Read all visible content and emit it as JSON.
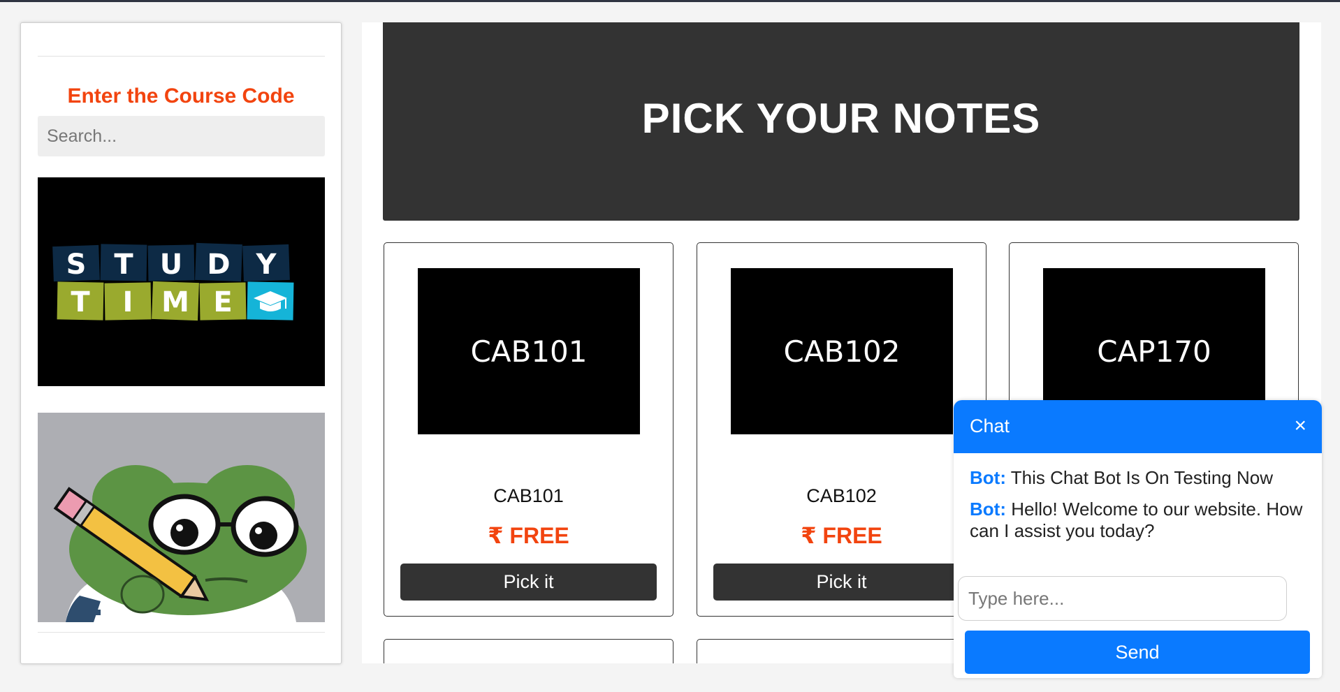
{
  "sidebar": {
    "heading": "Enter the Course Code",
    "search_placeholder": "Search...",
    "promo_logo_letters_top": [
      "S",
      "T",
      "U",
      "D",
      "Y"
    ],
    "promo_logo_letters_bottom": [
      "T",
      "I",
      "M",
      "E"
    ]
  },
  "banner": {
    "title": "PICK YOUR NOTES"
  },
  "courses": [
    {
      "thumb": "CAB101",
      "code": "CAB101",
      "price": "₹ FREE",
      "button": "Pick it"
    },
    {
      "thumb": "CAB102",
      "code": "CAB102",
      "price": "₹ FREE",
      "button": "Pick it"
    },
    {
      "thumb": "CAP170",
      "code": "",
      "price": "",
      "button": ""
    }
  ],
  "chat": {
    "title": "Chat",
    "close": "×",
    "messages": [
      {
        "who": "Bot:",
        "text": "This Chat Bot Is On Testing Now"
      },
      {
        "who": "Bot:",
        "text": "Hello! Welcome to our website. How can I assist you today?"
      }
    ],
    "input_placeholder": "Type here...",
    "send_label": "Send"
  },
  "colors": {
    "accent_orange": "#f2440f",
    "chat_blue": "#0a7aff",
    "dark": "#333333",
    "logo_navy": "#0d2a45",
    "logo_green": "#9aaa2e",
    "logo_cyan": "#15b4d8"
  }
}
